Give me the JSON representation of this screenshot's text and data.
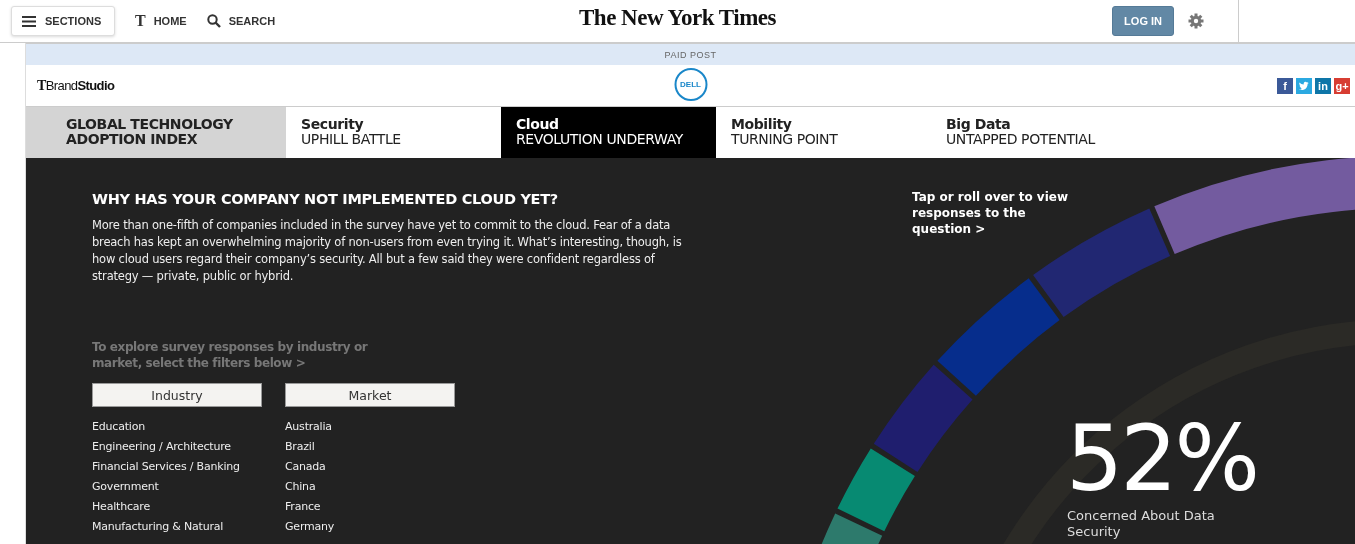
{
  "header": {
    "sections_button": "SECTIONS",
    "home_mark": "T",
    "home_link": "HOME",
    "search_link": "SEARCH",
    "logo": "The New York Times",
    "login_button": "LOG IN"
  },
  "paid_post": "PAID POST",
  "brand_bar": {
    "brand_mark": "T",
    "brand": "Brand**Studio**",
    "sponsor_logo": "DELL",
    "social": [
      {
        "kind": "facebook",
        "label": "f"
      },
      {
        "kind": "twitter"
      },
      {
        "kind": "linkedin",
        "label": "in"
      },
      {
        "kind": "googleplus",
        "label": "g+"
      }
    ]
  },
  "tabs": [
    {
      "kind": "index",
      "title": "GLOBAL TECHNOLOGY",
      "subtitle": "ADOPTION INDEX",
      "selected": false
    },
    {
      "kind": "section",
      "title": "Security",
      "subtitle": "UPHILL BATTLE",
      "selected": false
    },
    {
      "kind": "section",
      "title": "Cloud",
      "subtitle": "REVOLUTION UNDERWAY",
      "selected": true
    },
    {
      "kind": "section",
      "title": "Mobility",
      "subtitle": "TURNING POINT",
      "selected": false
    },
    {
      "kind": "section",
      "title": "Big Data",
      "subtitle": "UNTAPPED POTENTIAL",
      "selected": false
    }
  ],
  "article": {
    "heading": "WHY HAS YOUR COMPANY NOT IMPLEMENTED CLOUD YET?",
    "body": "More than one-fifth of companies included in the survey have yet to commit to the cloud. Fear of a data breach has kept an overwhelming majority of non-users from even trying it. What’s interesting, though, is how cloud users regard their company’s security. All but a few said they were confident regardless of strategy — private, public or hybrid.",
    "hint": "To explore survey responses by industry or market, select the filters below >",
    "filters": [
      {
        "label": "Industry",
        "items": [
          "Education",
          "Engineering / Architecture",
          "Financial Services / Banking",
          "Government",
          "Healthcare",
          "Manufacturing & Natural"
        ]
      },
      {
        "label": "Market",
        "items": [
          "Australia",
          "Brazil",
          "Canada",
          "China",
          "France",
          "Germany"
        ]
      }
    ]
  },
  "chart_panel": {
    "prompt": "Tap or roll over to view responses to the question >",
    "stat_value": "52%",
    "stat_label": "Concerned About Data Security"
  }
}
